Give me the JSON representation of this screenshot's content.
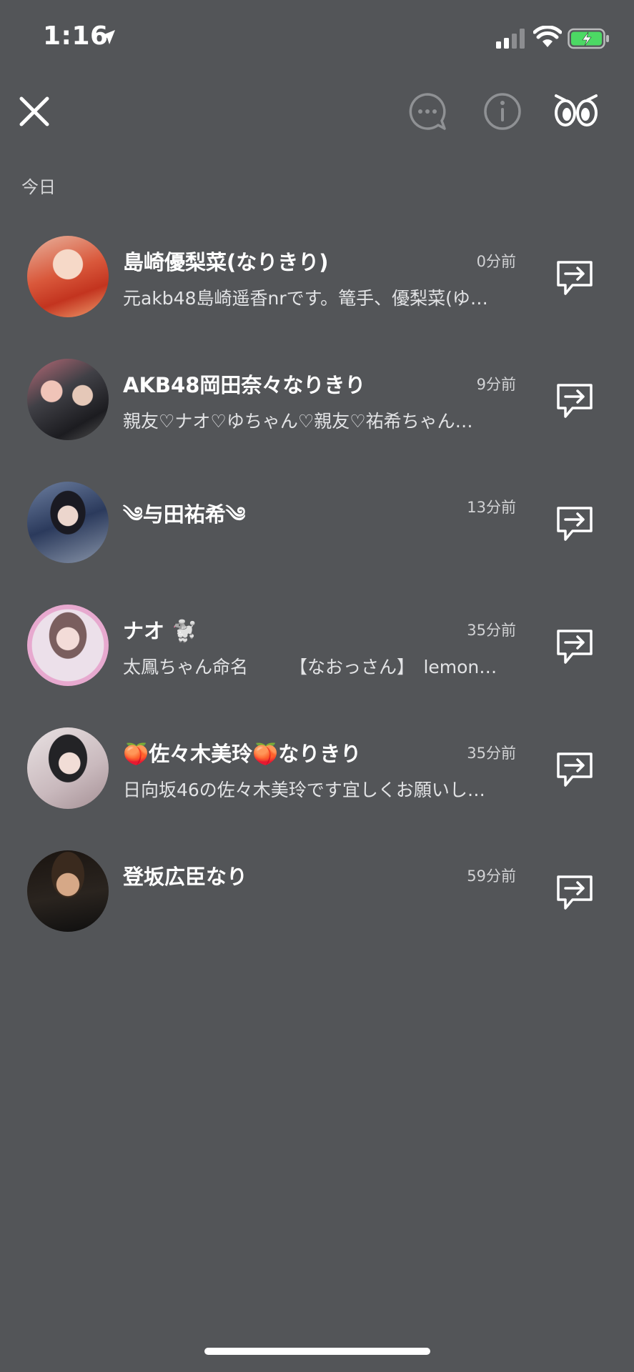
{
  "status_bar": {
    "time": "1:16"
  },
  "header": {
    "section_label": "今日"
  },
  "friends": [
    {
      "name": "島崎優梨菜(なりきり)",
      "time": "0分前",
      "preview": "元akb48島崎遥香nrです。篭手、優梨菜(ゆ…"
    },
    {
      "name": "AKB48岡田奈々なりきり",
      "time": "9分前",
      "preview": "親友♡ナオ♡ゆちゃん♡親友♡祐希ちゃん…"
    },
    {
      "name": "༄与田祐希༄",
      "time": "13分前",
      "preview": ""
    },
    {
      "name": "ナオ 🐩",
      "time": "35分前",
      "preview": "太鳳ちゃん命名　　 【なおっさん】　lemon…"
    },
    {
      "name": "🍑佐々木美玲🍑なりきり",
      "time": "35分前",
      "preview": "日向坂46の佐々木美玲です宜しくお願いし…"
    },
    {
      "name": "登坂広臣なり",
      "time": "59分前",
      "preview": ""
    }
  ],
  "icons": {
    "close": "close-icon",
    "chat": "chat-bubble-icon",
    "info": "info-icon",
    "eyes": "eyes-icon",
    "message": "message-reply-icon"
  },
  "colors": {
    "background": "#535558",
    "battery": "#4cd964"
  }
}
